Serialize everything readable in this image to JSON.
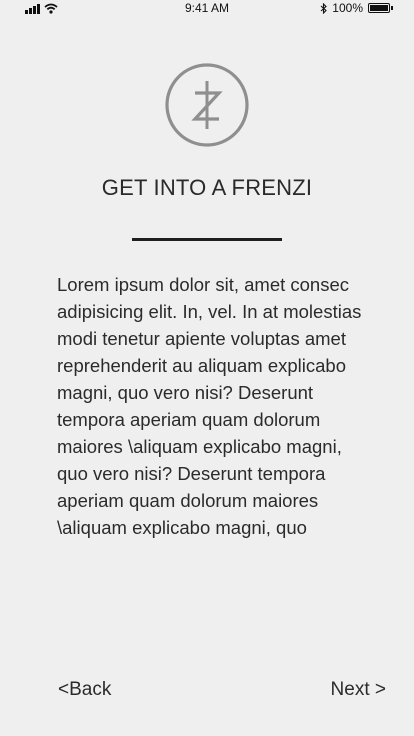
{
  "status_bar": {
    "time": "9:41 AM",
    "battery_text": "100%",
    "battery_level": 1.0,
    "icons": [
      "signal-icon",
      "wifi-icon",
      "bluetooth-icon",
      "battery-icon"
    ]
  },
  "logo": {
    "icon": "frenzi-logo-icon",
    "color": "#8f8f8f"
  },
  "page": {
    "title": "GET INTO A FRENZI",
    "body": "Lorem ipsum dolor sit, amet consec adipisicing elit. In, vel. In at molestias modi tenetur apiente voluptas amet reprehenderit au aliquam explicabo magni, quo vero nisi? Deserunt tempora aperiam quam dolorum maiores \\aliquam explicabo magni, quo vero nisi? Deserunt tempora aperiam quam dolorum maiores \\aliquam explicabo magni, quo"
  },
  "navigation": {
    "back_label": "<Back",
    "next_label": "Next >"
  },
  "colors": {
    "background": "#efefef",
    "text": "#2b2b2b",
    "rule": "#1f1f1f"
  }
}
